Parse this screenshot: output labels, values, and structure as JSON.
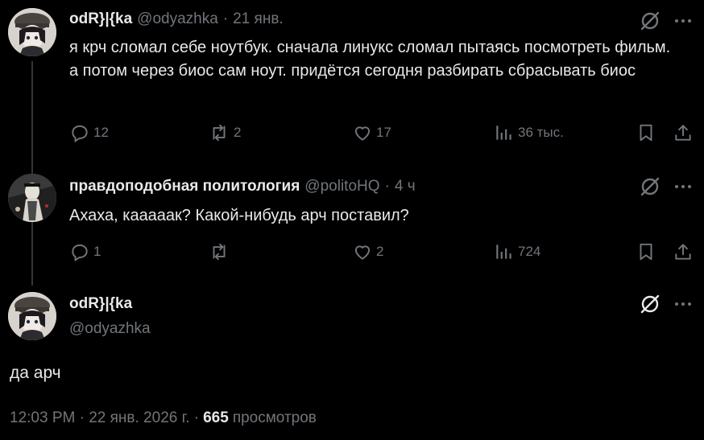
{
  "tweets": [
    {
      "display_name": "odR}|{ka",
      "handle": "@odyazhka",
      "sep": "·",
      "time": "21 янв.",
      "text": "я крч сломал себе ноутбук. сначала линукс сломал пытаясь посмотреть фильм. а потом через биос сам ноут. придётся сегодня разбирать сбрасывать биос",
      "replies": "12",
      "reposts": "2",
      "likes": "17",
      "views": "36 тыс."
    },
    {
      "display_name": "правдоподобная политология",
      "handle": "@politoHQ",
      "sep": "·",
      "time": "4 ч",
      "text": "Ахаха, кааааак? Какой-нибудь арч поставил?",
      "replies": "1",
      "reposts": "",
      "likes": "2",
      "views": "724"
    }
  ],
  "main": {
    "display_name": "odR}|{ka",
    "handle": "@odyazhka",
    "text": "да арч",
    "timestamp": "12:03 PM · 22 янв. 2026 г. ·",
    "views_count": "665",
    "views_label": "просмотров"
  },
  "icons": {
    "reply": "reply-icon",
    "repost": "repost-icon",
    "like": "like-icon",
    "views": "views-icon",
    "bookmark": "bookmark-icon",
    "share": "share-icon",
    "grok": "grok-icon",
    "more": "more-icon"
  },
  "colors": {
    "background": "#000000",
    "text": "#e7e9ea",
    "muted": "#71767b",
    "thread_line": "#333639"
  }
}
